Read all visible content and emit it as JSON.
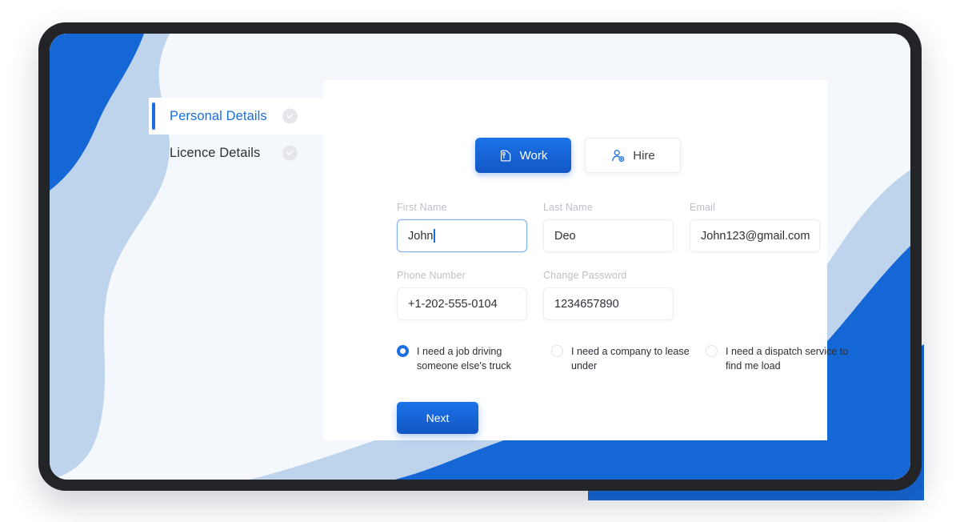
{
  "theme": {
    "accent_blue": "#1a6ee0",
    "deep_blue": "#1257c4",
    "light_blue_wave": "#bed3ec",
    "screen_bg": "#f4f8fc",
    "frame": "#222428",
    "label_gray": "#bcc0c8",
    "text_dark": "#2b2f36"
  },
  "sidebar": {
    "steps": [
      {
        "label": "Personal Details",
        "active": true,
        "check_icon": "check-circle-icon"
      },
      {
        "label": "Licence Details",
        "active": false,
        "check_icon": "check-circle-icon"
      }
    ]
  },
  "tabs": [
    {
      "label": "Work",
      "icon": "briefcase-tag-icon",
      "selected": true
    },
    {
      "label": "Hire",
      "icon": "person-add-icon",
      "selected": false
    }
  ],
  "form": {
    "rows": [
      [
        {
          "label": "First Name",
          "value": "John",
          "focused": true
        },
        {
          "label": "Last Name",
          "value": "Deo",
          "focused": false
        },
        {
          "label": "Email",
          "value": "John123@gmail.com",
          "focused": false
        }
      ],
      [
        {
          "label": "Phone Number",
          "value": "+1-202-555-0104",
          "focused": false
        },
        {
          "label": "Change Password",
          "value": "1234657890",
          "focused": false
        }
      ]
    ]
  },
  "radio_group": {
    "options": [
      {
        "label": "I need a job driving someone else's truck",
        "selected": true
      },
      {
        "label": "I need a company to lease under",
        "selected": false
      },
      {
        "label": "I need a dispatch service to  find me load",
        "selected": false
      }
    ]
  },
  "actions": {
    "next_label": "Next"
  }
}
